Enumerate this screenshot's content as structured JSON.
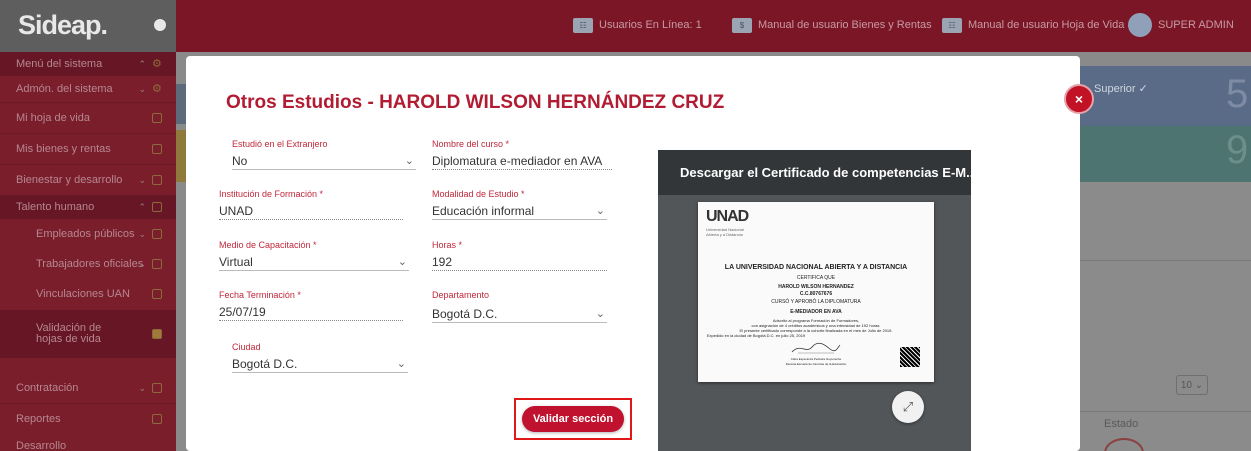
{
  "app": {
    "logo": "Sideap."
  },
  "topbar": {
    "online_users": "Usuarios En Línea: 1",
    "manual_bienes": "Manual de usuario Bienes y Rentas",
    "manual_hoja": "Manual de usuario Hoja de Vida",
    "user": "SUPER ADMIN"
  },
  "sidebar": {
    "items": [
      {
        "label": "Menú del sistema"
      },
      {
        "label": "Admón. del sistema"
      },
      {
        "label": "Mi hoja de vida"
      },
      {
        "label": "Mis bienes y rentas"
      },
      {
        "label": "Bienestar y desarrollo"
      },
      {
        "label": "Talento humano"
      },
      {
        "label": "Empleados públicos"
      },
      {
        "label": "Trabajadores oficiales"
      },
      {
        "label": "Vinculaciones UAN"
      },
      {
        "label": "Validación de hojas de vida"
      },
      {
        "label": "Contratación"
      },
      {
        "label": "Reportes"
      },
      {
        "label": "Desarrollo"
      }
    ]
  },
  "background": {
    "superior": "Superior ✓",
    "number_5": "5",
    "number_9": "9",
    "page_size": "10",
    "estado": "Estado"
  },
  "modal": {
    "title": "Otros Estudios - HAROLD WILSON HERNÁNDEZ CRUZ",
    "fields": {
      "extranjero": {
        "label": "Estudió en el Extranjero",
        "value": "No"
      },
      "curso": {
        "label": "Nombre del curso *",
        "value": "Diplomatura e-mediador en AVA"
      },
      "institucion": {
        "label": "Institución de Formación *",
        "value": "UNAD"
      },
      "modalidad": {
        "label": "Modalidad de Estudio *",
        "value": "Educación informal"
      },
      "medio": {
        "label": "Medio de Capacitación *",
        "value": "Virtual"
      },
      "horas": {
        "label": "Horas *",
        "value": "192"
      },
      "fecha": {
        "label": "Fecha Terminación *",
        "value": "25/07/19"
      },
      "departamento": {
        "label": "Departamento",
        "value": "Bogotá D.C."
      },
      "ciudad": {
        "label": "Ciudad",
        "value": "Bogotá D.C."
      }
    },
    "validate_label": "Validar sección",
    "close_label": "×"
  },
  "preview": {
    "header": "Descargar el Certificado de competencias E-M...",
    "certificate": {
      "logo": "UNAD",
      "logo_sub": "Universidad Nacional Abierta y a Distancia",
      "university": "LA UNIVERSIDAD NACIONAL ABIERTA Y A DISTANCIA",
      "certifies": "CERTIFICA QUE",
      "name": "HAROLD WILSON HERNANDEZ",
      "id": "C.C.80767676",
      "completed": "CURSÓ Y APROBÓ LA DIPLOMATURA",
      "course": "E-MEDIADOR EN AVA",
      "line1": "Adscrito al programa Formación de Formadores,",
      "line2": "con asignación de 4 créditos académicos y una intensidad de 192 horas.",
      "line3": "El presente certificado corresponde a la cohorte finalizada en el mes de Julio de 2019.",
      "line4": "Expedido en la ciudad de Bogotá D.C. en julio 25, 2019",
      "signer": "Clara Esperanza Pedraza Goyeneche",
      "signer_role": "Decana Escuela de Ciencias de la Educación"
    }
  }
}
